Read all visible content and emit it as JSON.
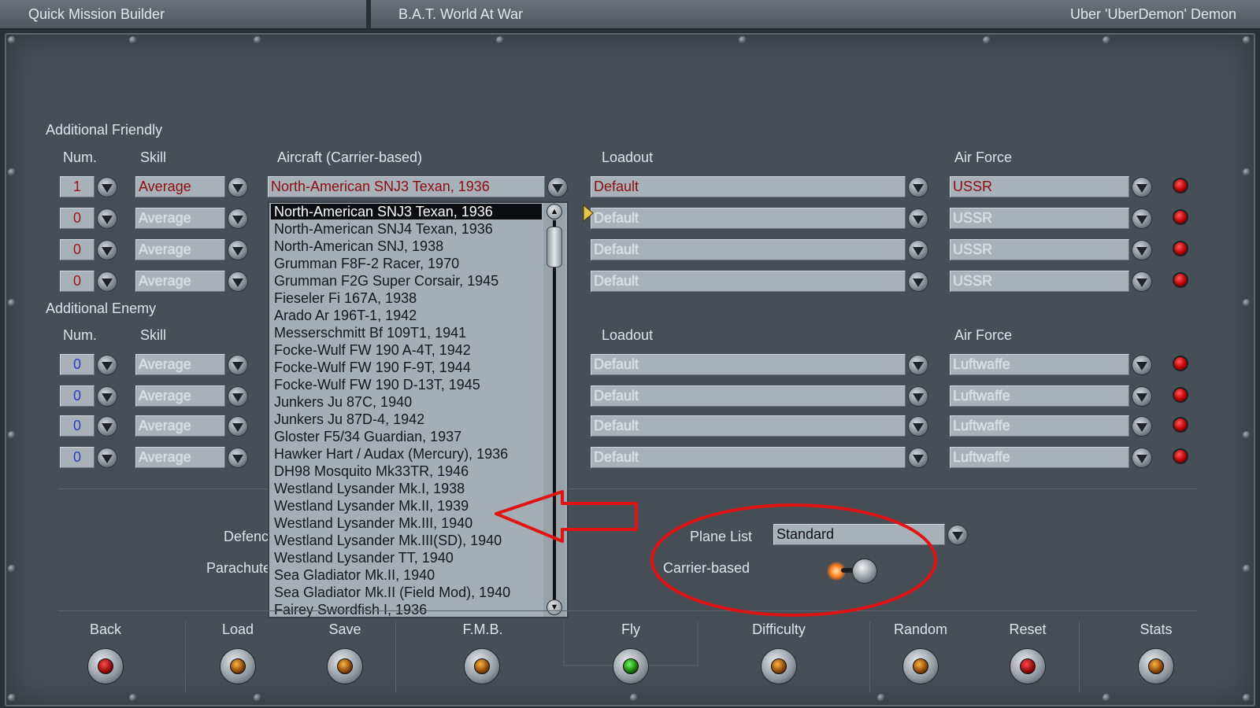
{
  "titlebar": {
    "left": "Quick Mission Builder",
    "center": "B.A.T. World At War",
    "user": "Uber 'UberDemon' Demon"
  },
  "friendly": {
    "section": "Additional Friendly",
    "headers": {
      "num": "Num.",
      "skill": "Skill",
      "aircraft": "Aircraft (Carrier-based)",
      "loadout": "Loadout",
      "airforce": "Air Force"
    },
    "rows": [
      {
        "num": "1",
        "skill": "Average",
        "aircraft": "North-American SNJ3 Texan, 1936",
        "loadout": "Default",
        "airforce": "USSR"
      },
      {
        "num": "0",
        "skill": "Average",
        "loadout": "Default",
        "airforce": "USSR"
      },
      {
        "num": "0",
        "skill": "Average",
        "loadout": "Default",
        "airforce": "USSR"
      },
      {
        "num": "0",
        "skill": "Average",
        "loadout": "Default",
        "airforce": "USSR"
      }
    ]
  },
  "enemy": {
    "section": "Additional Enemy",
    "headers": {
      "num": "Num.",
      "skill": "Skill",
      "loadout": "Loadout",
      "airforce": "Air Force"
    },
    "rows": [
      {
        "num": "0",
        "skill": "Average",
        "loadout": "Default",
        "airforce": "Luftwaffe"
      },
      {
        "num": "0",
        "skill": "Average",
        "loadout": "Default",
        "airforce": "Luftwaffe"
      },
      {
        "num": "0",
        "skill": "Average",
        "loadout": "Default",
        "airforce": "Luftwaffe"
      },
      {
        "num": "0",
        "skill": "Average",
        "loadout": "Default",
        "airforce": "Luftwaffe"
      }
    ]
  },
  "aircraft_list": [
    "North-American SNJ3 Texan, 1936",
    "North-American SNJ4 Texan, 1936",
    "North-American SNJ, 1938",
    "Grumman F8F-2 Racer, 1970",
    "Grumman F2G Super Corsair, 1945",
    "Fieseler Fi 167A, 1938",
    "Arado Ar 196T-1, 1942",
    "Messerschmitt Bf 109T1, 1941",
    "Focke-Wulf FW 190 A-4T, 1942",
    "Focke-Wulf FW 190 F-9T, 1944",
    "Focke-Wulf FW 190 D-13T, 1945",
    "Junkers Ju 87C, 1940",
    "Junkers Ju 87D-4, 1942",
    "Gloster F5/34 Guardian, 1937",
    "Hawker Hart / Audax (Mercury), 1936",
    "DH98 Mosquito Mk33TR, 1946",
    "Westland Lysander Mk.I, 1938",
    "Westland Lysander Mk.II, 1939",
    "Westland Lysander Mk.III, 1940",
    "Westland Lysander Mk.III(SD), 1940",
    "Westland Lysander TT, 1940",
    "Sea Gladiator Mk.II, 1940",
    "Sea Gladiator Mk.II (Field Mod), 1940",
    "Fairey Swordfish I, 1936"
  ],
  "options": {
    "defense_label_partial": "Defenc",
    "parachute_label_partial": "Parachute",
    "plane_list_label": "Plane List",
    "plane_list_value": "Standard",
    "carrier_label": "Carrier-based"
  },
  "bottom_buttons": {
    "back": "Back",
    "load": "Load",
    "save": "Save",
    "fmb": "F.M.B.",
    "fly": "Fly",
    "difficulty": "Difficulty",
    "random": "Random",
    "reset": "Reset",
    "stats": "Stats"
  },
  "colors": {
    "active_text": "#8b0d12",
    "annotation": "#e01414",
    "panel": "#474e55"
  }
}
